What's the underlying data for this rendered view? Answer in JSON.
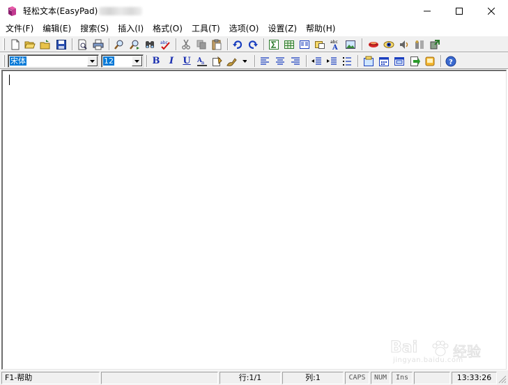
{
  "window": {
    "title": "轻松文本(EasyPad)"
  },
  "menu": [
    {
      "label": "文件(F)"
    },
    {
      "label": "编辑(E)"
    },
    {
      "label": "搜索(S)"
    },
    {
      "label": "插入(I)"
    },
    {
      "label": "格式(O)"
    },
    {
      "label": "工具(T)"
    },
    {
      "label": "选项(O)"
    },
    {
      "label": "设置(Z)"
    },
    {
      "label": "帮助(H)"
    }
  ],
  "format_toolbar": {
    "font_name": "宋体",
    "font_size": "12",
    "bold_label": "B",
    "italic_label": "I",
    "underline_label": "U"
  },
  "status": {
    "help": "F1-帮助",
    "line": "行:1/1",
    "column": "列:1",
    "caps": "CAPS",
    "num": "NUM",
    "ins": "Ins",
    "time": "13:33:26"
  },
  "watermark": {
    "brand": "Bai",
    "text": "经验",
    "url": "jingyan.baidu.com"
  },
  "colors": {
    "accent": "#0078d7",
    "toolbar_bg": "#f0f0f0",
    "icon_blue": "#1a2fb0"
  }
}
